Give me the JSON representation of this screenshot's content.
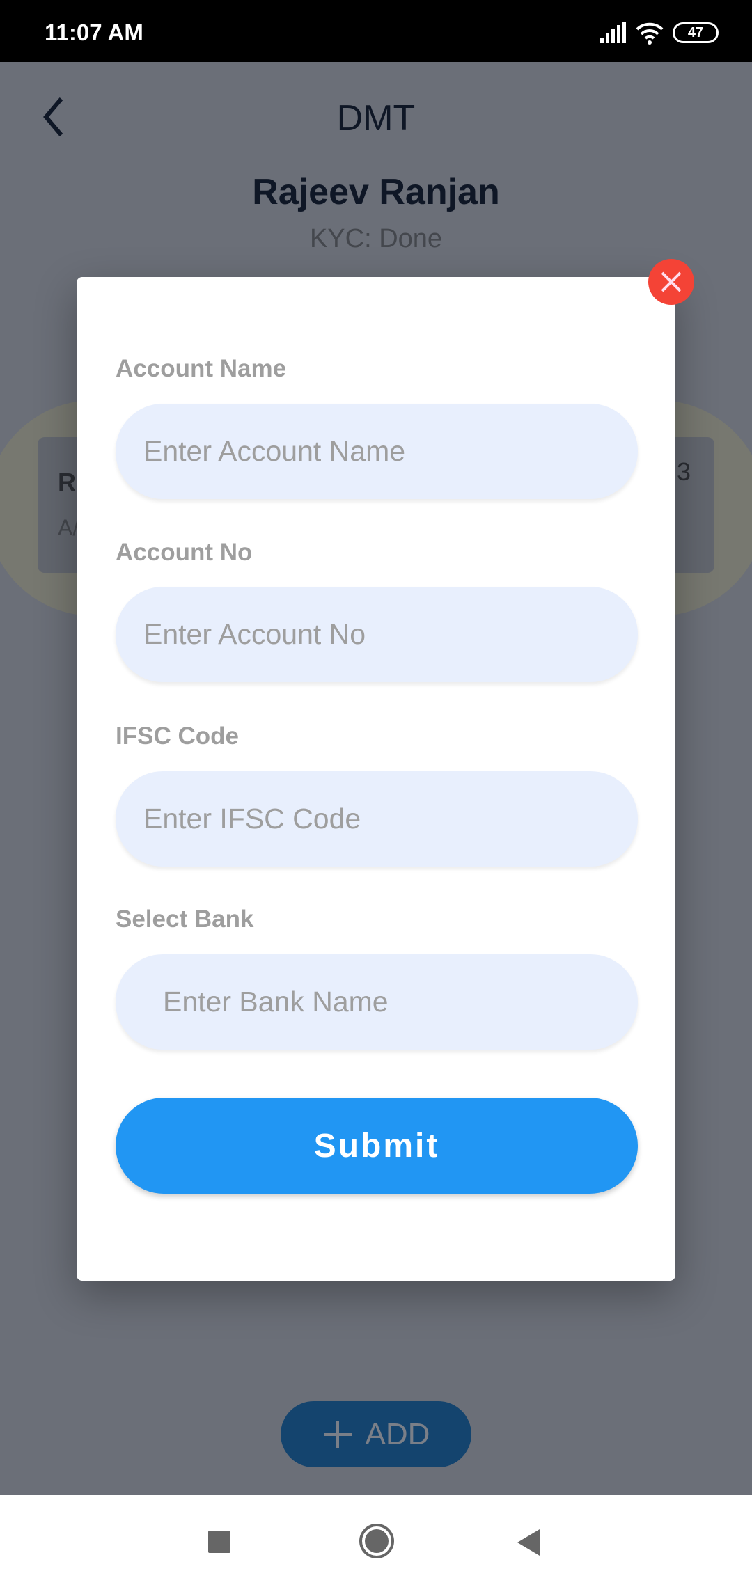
{
  "status_bar": {
    "time": "11:07 AM",
    "battery": "47",
    "icons": [
      "signal-icon",
      "wifi-icon",
      "battery-icon"
    ]
  },
  "header": {
    "title": "DMT",
    "back_icon": "chevron-left-icon"
  },
  "customer": {
    "name": "Rajeev Ranjan",
    "kyc": "KYC: Done"
  },
  "background_card": {
    "name_partial": "Ra",
    "account_partial": "A/",
    "value_partial": "3"
  },
  "add_button": {
    "label": "ADD",
    "icon": "plus-icon"
  },
  "modal": {
    "close_icon": "close-icon",
    "fields": [
      {
        "label": "Account Name",
        "placeholder": "Enter Account Name",
        "value": ""
      },
      {
        "label": "Account No",
        "placeholder": "Enter Account No",
        "value": ""
      },
      {
        "label": "IFSC Code",
        "placeholder": "Enter IFSC Code",
        "value": ""
      },
      {
        "label": "Select Bank",
        "placeholder": "Enter Bank Name",
        "value": ""
      }
    ],
    "submit_label": "Submit"
  },
  "colors": {
    "accent": "#2196F3",
    "close": "#F44336",
    "input_bg": "#E8EFFD"
  }
}
